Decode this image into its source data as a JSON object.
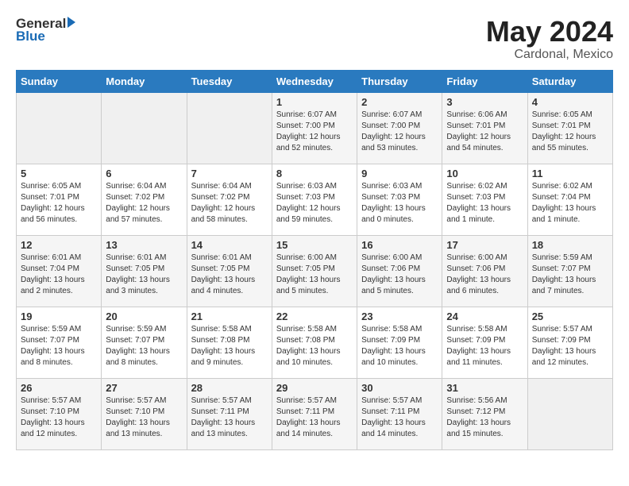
{
  "logo": {
    "line1": "General",
    "line2": "Blue"
  },
  "title": {
    "month_year": "May 2024",
    "location": "Cardonal, Mexico"
  },
  "days_of_week": [
    "Sunday",
    "Monday",
    "Tuesday",
    "Wednesday",
    "Thursday",
    "Friday",
    "Saturday"
  ],
  "weeks": [
    [
      {
        "day": "",
        "info": ""
      },
      {
        "day": "",
        "info": ""
      },
      {
        "day": "",
        "info": ""
      },
      {
        "day": "1",
        "info": "Sunrise: 6:07 AM\nSunset: 7:00 PM\nDaylight: 12 hours\nand 52 minutes."
      },
      {
        "day": "2",
        "info": "Sunrise: 6:07 AM\nSunset: 7:00 PM\nDaylight: 12 hours\nand 53 minutes."
      },
      {
        "day": "3",
        "info": "Sunrise: 6:06 AM\nSunset: 7:01 PM\nDaylight: 12 hours\nand 54 minutes."
      },
      {
        "day": "4",
        "info": "Sunrise: 6:05 AM\nSunset: 7:01 PM\nDaylight: 12 hours\nand 55 minutes."
      }
    ],
    [
      {
        "day": "5",
        "info": "Sunrise: 6:05 AM\nSunset: 7:01 PM\nDaylight: 12 hours\nand 56 minutes."
      },
      {
        "day": "6",
        "info": "Sunrise: 6:04 AM\nSunset: 7:02 PM\nDaylight: 12 hours\nand 57 minutes."
      },
      {
        "day": "7",
        "info": "Sunrise: 6:04 AM\nSunset: 7:02 PM\nDaylight: 12 hours\nand 58 minutes."
      },
      {
        "day": "8",
        "info": "Sunrise: 6:03 AM\nSunset: 7:03 PM\nDaylight: 12 hours\nand 59 minutes."
      },
      {
        "day": "9",
        "info": "Sunrise: 6:03 AM\nSunset: 7:03 PM\nDaylight: 13 hours\nand 0 minutes."
      },
      {
        "day": "10",
        "info": "Sunrise: 6:02 AM\nSunset: 7:03 PM\nDaylight: 13 hours\nand 1 minute."
      },
      {
        "day": "11",
        "info": "Sunrise: 6:02 AM\nSunset: 7:04 PM\nDaylight: 13 hours\nand 1 minute."
      }
    ],
    [
      {
        "day": "12",
        "info": "Sunrise: 6:01 AM\nSunset: 7:04 PM\nDaylight: 13 hours\nand 2 minutes."
      },
      {
        "day": "13",
        "info": "Sunrise: 6:01 AM\nSunset: 7:05 PM\nDaylight: 13 hours\nand 3 minutes."
      },
      {
        "day": "14",
        "info": "Sunrise: 6:01 AM\nSunset: 7:05 PM\nDaylight: 13 hours\nand 4 minutes."
      },
      {
        "day": "15",
        "info": "Sunrise: 6:00 AM\nSunset: 7:05 PM\nDaylight: 13 hours\nand 5 minutes."
      },
      {
        "day": "16",
        "info": "Sunrise: 6:00 AM\nSunset: 7:06 PM\nDaylight: 13 hours\nand 5 minutes."
      },
      {
        "day": "17",
        "info": "Sunrise: 6:00 AM\nSunset: 7:06 PM\nDaylight: 13 hours\nand 6 minutes."
      },
      {
        "day": "18",
        "info": "Sunrise: 5:59 AM\nSunset: 7:07 PM\nDaylight: 13 hours\nand 7 minutes."
      }
    ],
    [
      {
        "day": "19",
        "info": "Sunrise: 5:59 AM\nSunset: 7:07 PM\nDaylight: 13 hours\nand 8 minutes."
      },
      {
        "day": "20",
        "info": "Sunrise: 5:59 AM\nSunset: 7:07 PM\nDaylight: 13 hours\nand 8 minutes."
      },
      {
        "day": "21",
        "info": "Sunrise: 5:58 AM\nSunset: 7:08 PM\nDaylight: 13 hours\nand 9 minutes."
      },
      {
        "day": "22",
        "info": "Sunrise: 5:58 AM\nSunset: 7:08 PM\nDaylight: 13 hours\nand 10 minutes."
      },
      {
        "day": "23",
        "info": "Sunrise: 5:58 AM\nSunset: 7:09 PM\nDaylight: 13 hours\nand 10 minutes."
      },
      {
        "day": "24",
        "info": "Sunrise: 5:58 AM\nSunset: 7:09 PM\nDaylight: 13 hours\nand 11 minutes."
      },
      {
        "day": "25",
        "info": "Sunrise: 5:57 AM\nSunset: 7:09 PM\nDaylight: 13 hours\nand 12 minutes."
      }
    ],
    [
      {
        "day": "26",
        "info": "Sunrise: 5:57 AM\nSunset: 7:10 PM\nDaylight: 13 hours\nand 12 minutes."
      },
      {
        "day": "27",
        "info": "Sunrise: 5:57 AM\nSunset: 7:10 PM\nDaylight: 13 hours\nand 13 minutes."
      },
      {
        "day": "28",
        "info": "Sunrise: 5:57 AM\nSunset: 7:11 PM\nDaylight: 13 hours\nand 13 minutes."
      },
      {
        "day": "29",
        "info": "Sunrise: 5:57 AM\nSunset: 7:11 PM\nDaylight: 13 hours\nand 14 minutes."
      },
      {
        "day": "30",
        "info": "Sunrise: 5:57 AM\nSunset: 7:11 PM\nDaylight: 13 hours\nand 14 minutes."
      },
      {
        "day": "31",
        "info": "Sunrise: 5:56 AM\nSunset: 7:12 PM\nDaylight: 13 hours\nand 15 minutes."
      },
      {
        "day": "",
        "info": ""
      }
    ]
  ]
}
